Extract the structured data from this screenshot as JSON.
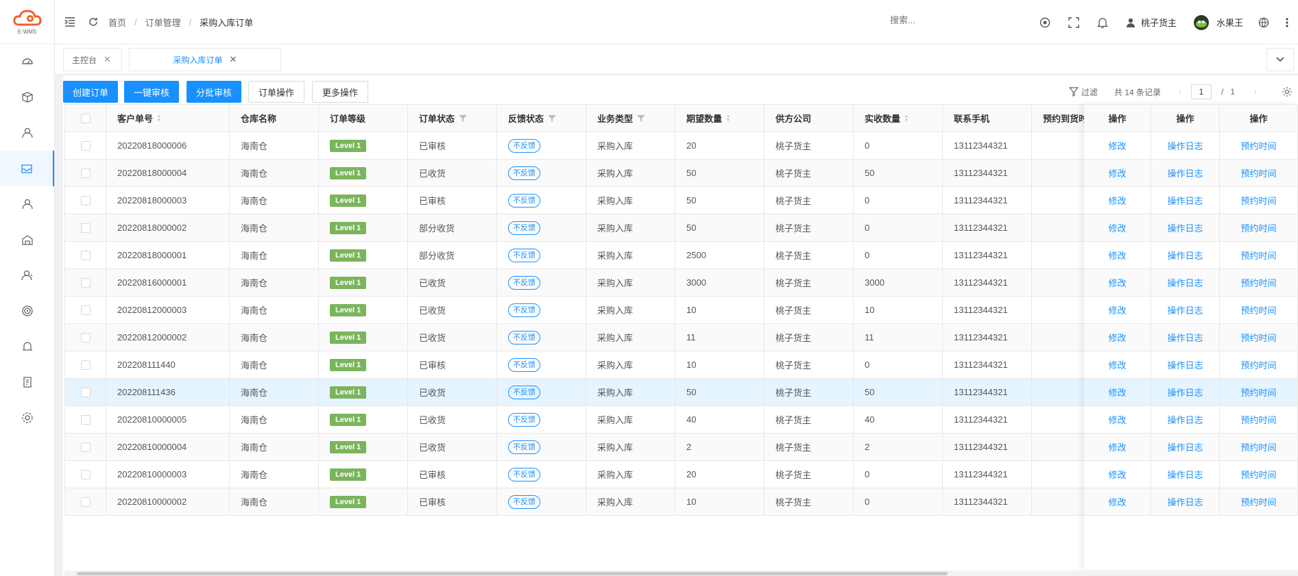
{
  "brand": {
    "logo_text": "E-WMS",
    "accent": "#1890ff",
    "level_color": "#7ab55c"
  },
  "sidebar": {
    "items": [
      {
        "icon": "dashboard-icon"
      },
      {
        "icon": "box-icon"
      },
      {
        "icon": "user-icon"
      },
      {
        "icon": "inbox-icon",
        "active": true
      },
      {
        "icon": "person-icon"
      },
      {
        "icon": "warehouse-icon"
      },
      {
        "icon": "user-group-icon"
      },
      {
        "icon": "target-icon"
      },
      {
        "icon": "bell-alt-icon"
      },
      {
        "icon": "document-icon"
      },
      {
        "icon": "settings-icon"
      }
    ]
  },
  "header": {
    "breadcrumb": [
      "首页",
      "订单管理",
      "采购入库订单"
    ],
    "search_placeholder": "搜索...",
    "owner": "桃子货主",
    "user": "水果王"
  },
  "tabs": [
    {
      "label": "主控台",
      "active": false
    },
    {
      "label": "采购入库订单",
      "active": true
    }
  ],
  "toolbar": {
    "create": "创建订单",
    "one_click_review": "一键审核",
    "batch_review": "分批审核",
    "order_ops": "订单操作",
    "more_ops": "更多操作",
    "filter": "过滤",
    "total": "共 14 条记录",
    "page": "1",
    "page_sep": "/",
    "page_total": "1"
  },
  "columns": {
    "order_no": "客户单号",
    "warehouse": "仓库名称",
    "level": "订单等级",
    "status": "订单状态",
    "feedback": "反馈状态",
    "biz_type": "业务类型",
    "expected_qty": "期望数量",
    "supplier": "供方公司",
    "received_qty": "实收数量",
    "phone": "联系手机",
    "appointment": "预约到货时间",
    "op1": "操作",
    "op2": "操作",
    "op3": "操作"
  },
  "actions": {
    "edit": "修改",
    "log": "操作日志",
    "appoint": "预约时间"
  },
  "rows": [
    {
      "order_no": "20220818000006",
      "warehouse": "海南仓",
      "level": "Level 1",
      "status": "已审核",
      "feedback": "不反馈",
      "biz_type": "采购入库",
      "expected_qty": "20",
      "supplier": "桃子货主",
      "received_qty": "0",
      "phone": "13112344321",
      "appointment": ""
    },
    {
      "order_no": "20220818000004",
      "warehouse": "海南仓",
      "level": "Level 1",
      "status": "已收货",
      "feedback": "不反馈",
      "biz_type": "采购入库",
      "expected_qty": "50",
      "supplier": "桃子货主",
      "received_qty": "50",
      "phone": "13112344321",
      "appointment": ""
    },
    {
      "order_no": "20220818000003",
      "warehouse": "海南仓",
      "level": "Level 1",
      "status": "已审核",
      "feedback": "不反馈",
      "biz_type": "采购入库",
      "expected_qty": "50",
      "supplier": "桃子货主",
      "received_qty": "0",
      "phone": "13112344321",
      "appointment": ""
    },
    {
      "order_no": "20220818000002",
      "warehouse": "海南仓",
      "level": "Level 1",
      "status": "部分收货",
      "feedback": "不反馈",
      "biz_type": "采购入库",
      "expected_qty": "50",
      "supplier": "桃子货主",
      "received_qty": "0",
      "phone": "13112344321",
      "appointment": ""
    },
    {
      "order_no": "20220818000001",
      "warehouse": "海南仓",
      "level": "Level 1",
      "status": "部分收货",
      "feedback": "不反馈",
      "biz_type": "采购入库",
      "expected_qty": "2500",
      "supplier": "桃子货主",
      "received_qty": "0",
      "phone": "13112344321",
      "appointment": ""
    },
    {
      "order_no": "20220816000001",
      "warehouse": "海南仓",
      "level": "Level 1",
      "status": "已收货",
      "feedback": "不反馈",
      "biz_type": "采购入库",
      "expected_qty": "3000",
      "supplier": "桃子货主",
      "received_qty": "3000",
      "phone": "13112344321",
      "appointment": ""
    },
    {
      "order_no": "20220812000003",
      "warehouse": "海南仓",
      "level": "Level 1",
      "status": "已收货",
      "feedback": "不反馈",
      "biz_type": "采购入库",
      "expected_qty": "10",
      "supplier": "桃子货主",
      "received_qty": "10",
      "phone": "13112344321",
      "appointment": ""
    },
    {
      "order_no": "20220812000002",
      "warehouse": "海南仓",
      "level": "Level 1",
      "status": "已收货",
      "feedback": "不反馈",
      "biz_type": "采购入库",
      "expected_qty": "11",
      "supplier": "桃子货主",
      "received_qty": "11",
      "phone": "13112344321",
      "appointment": ""
    },
    {
      "order_no": "202208111440",
      "warehouse": "海南仓",
      "level": "Level 1",
      "status": "已审核",
      "feedback": "不反馈",
      "biz_type": "采购入库",
      "expected_qty": "10",
      "supplier": "桃子货主",
      "received_qty": "0",
      "phone": "13112344321",
      "appointment": ""
    },
    {
      "order_no": "202208111436",
      "warehouse": "海南仓",
      "level": "Level 1",
      "status": "已收货",
      "feedback": "不反馈",
      "biz_type": "采购入库",
      "expected_qty": "50",
      "supplier": "桃子货主",
      "received_qty": "50",
      "phone": "13112344321",
      "appointment": "",
      "highlight": true
    },
    {
      "order_no": "20220810000005",
      "warehouse": "海南仓",
      "level": "Level 1",
      "status": "已收货",
      "feedback": "不反馈",
      "biz_type": "采购入库",
      "expected_qty": "40",
      "supplier": "桃子货主",
      "received_qty": "40",
      "phone": "13112344321",
      "appointment": ""
    },
    {
      "order_no": "20220810000004",
      "warehouse": "海南仓",
      "level": "Level 1",
      "status": "已收货",
      "feedback": "不反馈",
      "biz_type": "采购入库",
      "expected_qty": "2",
      "supplier": "桃子货主",
      "received_qty": "2",
      "phone": "13112344321",
      "appointment": ""
    },
    {
      "order_no": "20220810000003",
      "warehouse": "海南仓",
      "level": "Level 1",
      "status": "已审核",
      "feedback": "不反馈",
      "biz_type": "采购入库",
      "expected_qty": "20",
      "supplier": "桃子货主",
      "received_qty": "0",
      "phone": "13112344321",
      "appointment": ""
    },
    {
      "order_no": "20220810000002",
      "warehouse": "海南仓",
      "level": "Level 1",
      "status": "已审核",
      "feedback": "不反馈",
      "biz_type": "采购入库",
      "expected_qty": "10",
      "supplier": "桃子货主",
      "received_qty": "0",
      "phone": "13112344321",
      "appointment": ""
    }
  ]
}
